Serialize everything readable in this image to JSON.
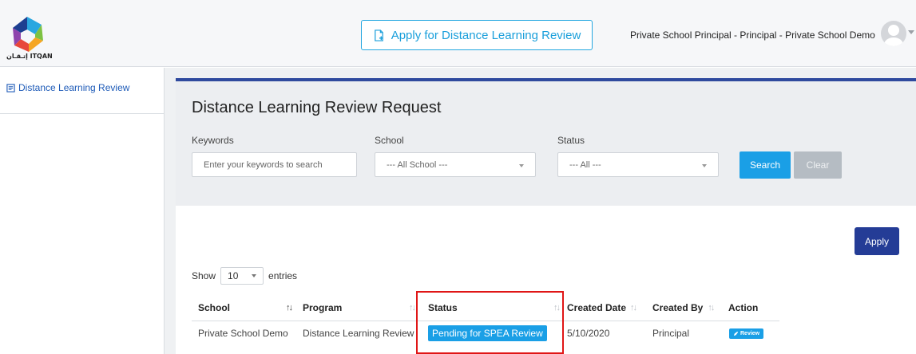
{
  "header": {
    "logo_text": "إتـقـان ITQAN",
    "apply_button_label": "Apply for Distance Learning Review",
    "user_label": "Private School Principal - Principal - Private School Demo"
  },
  "sidebar": {
    "items": [
      {
        "label": "Distance Learning Review",
        "icon": "document-icon"
      }
    ]
  },
  "page": {
    "title": "Distance Learning Review Request"
  },
  "filters": {
    "keywords_label": "Keywords",
    "keywords_placeholder": "Enter your keywords to search",
    "school_label": "School",
    "school_value": "--- All School ---",
    "status_label": "Status",
    "status_value": "--- All ---",
    "search_label": "Search",
    "clear_label": "Clear"
  },
  "actions": {
    "apply_label": "Apply"
  },
  "table": {
    "show_label": "Show",
    "entries_value": "10",
    "entries_label": "entries",
    "columns": [
      "School",
      "Program",
      "Status",
      "Created Date",
      "Created By",
      "Action"
    ],
    "rows": [
      {
        "school": "Private School Demo",
        "program": "Distance Learning Review",
        "status": "Pending for SPEA Review",
        "created_date": "5/10/2020",
        "created_by": "Principal",
        "action": "Review"
      }
    ]
  },
  "colors": {
    "accent_blue": "#1a9fe6",
    "navy": "#243c96",
    "rule_blue": "#2f4a9e",
    "highlight_red": "#e01616"
  }
}
